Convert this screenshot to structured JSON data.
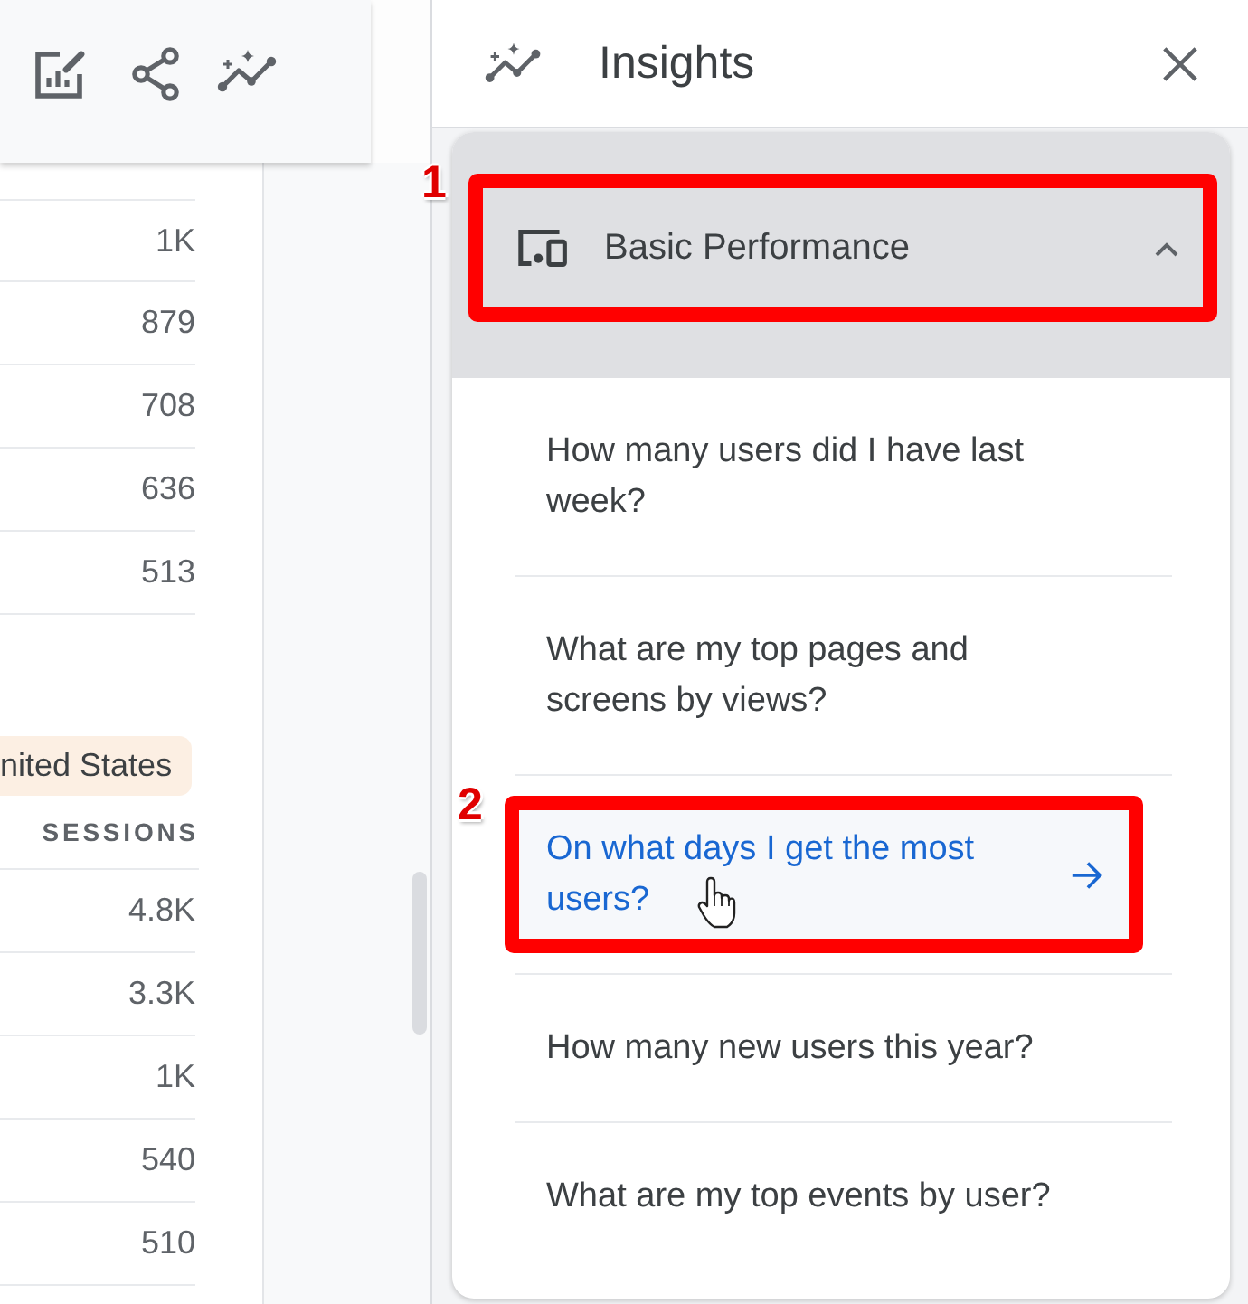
{
  "top_table": {
    "rows": [
      "1K",
      "879",
      "708",
      "636",
      "513"
    ]
  },
  "bottom_table": {
    "filter_chip": "nited States",
    "columns": [
      "SESSIONS"
    ],
    "rows": [
      "4.8K",
      "3.3K",
      "1K",
      "540",
      "510"
    ]
  },
  "insights_panel": {
    "title": "Insights",
    "section": {
      "title": "Basic Performance",
      "expanded": true,
      "callout": "1",
      "questions": [
        {
          "text": "How many users did I have last week?",
          "hovered": false
        },
        {
          "text": "What are my top pages and screens by views?",
          "hovered": false
        },
        {
          "text": "On what days I get the most users?",
          "hovered": true,
          "callout": "2"
        },
        {
          "text": "How many new users this year?",
          "hovered": false
        },
        {
          "text": "What are my top events by user?",
          "hovered": false
        }
      ]
    }
  }
}
